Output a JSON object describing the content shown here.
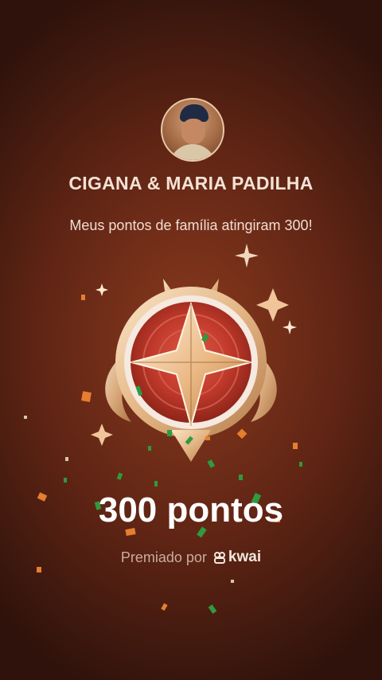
{
  "profile": {
    "name": "CIGANA & MARIA PADILHA"
  },
  "message": "Meus pontos de família atingiram 300!",
  "points_label": "300 pontos",
  "award": {
    "prefix": "Premiado por",
    "brand": "kwai"
  },
  "icons": {
    "badge": "star-medal-icon",
    "brand_logo": "kwai-logo-icon"
  },
  "colors": {
    "background_center": "#8a3a1e",
    "background_edge": "#2e120b",
    "medal_red": "#c0392b",
    "medal_gold": "#e8c49a",
    "confetti_green": "#2e8b3a",
    "confetti_orange": "#e0782c"
  }
}
